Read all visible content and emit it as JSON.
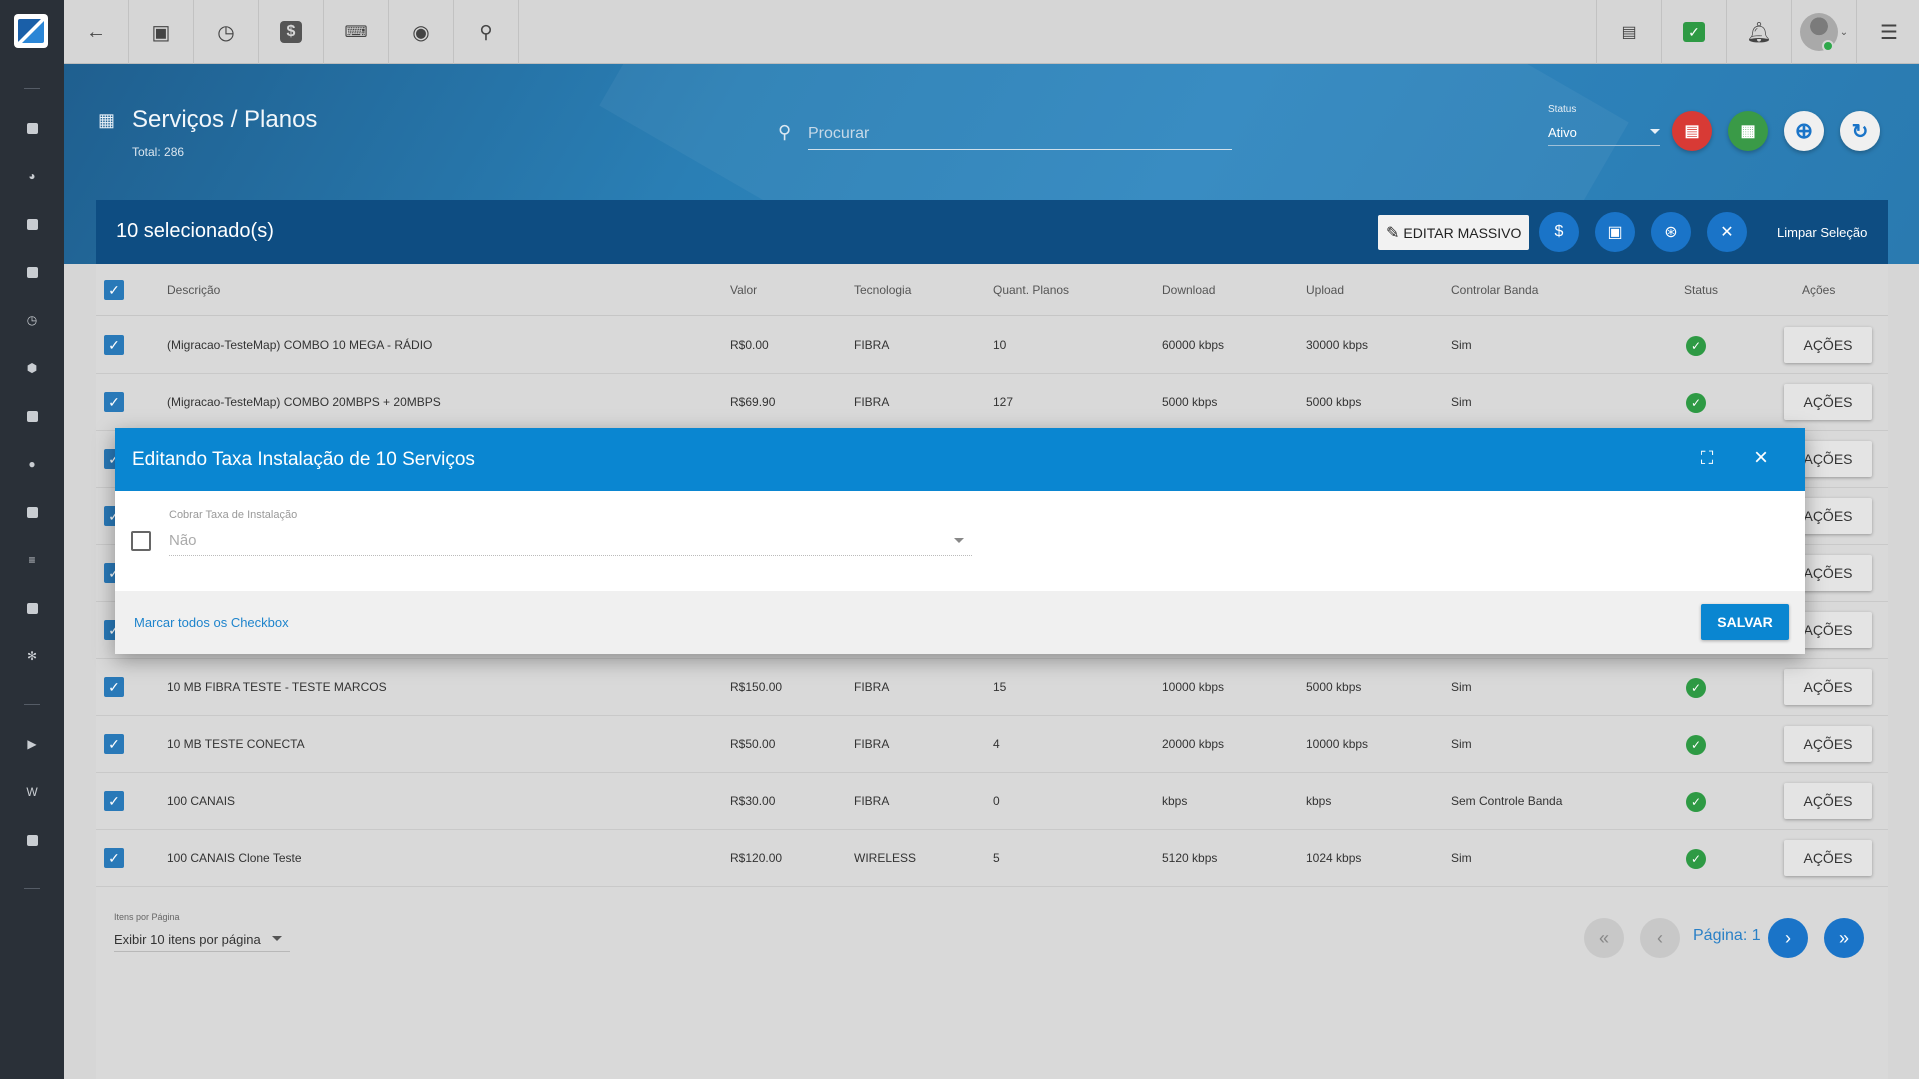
{
  "topbar": {
    "icons": [
      "back-arrow-icon",
      "contact-card-icon",
      "calendar-clock-icon",
      "dollar-icon",
      "terminal-icon",
      "eye-icon",
      "search-icon",
      "pdf-icon",
      "chat-check-icon",
      "bell-icon",
      "avatar",
      "menu-icon"
    ]
  },
  "page": {
    "title": "Serviços / Planos",
    "total": "Total: 286",
    "search_placeholder": "Procurar",
    "status_label": "Status",
    "status_value": "Ativo"
  },
  "selection": {
    "count": "10 selecionado(s)",
    "edit_mass": "EDITAR MASSIVO",
    "clear": "Limpar Seleção"
  },
  "table": {
    "headers": [
      "Descrição",
      "Valor",
      "Tecnologia",
      "Quant. Planos",
      "Download",
      "Upload",
      "Controlar Banda",
      "Status",
      "Ações"
    ],
    "rows": [
      {
        "desc": "(Migracao-TesteMap) COMBO 10 MEGA - RÁDIO",
        "valor": "R$0.00",
        "tec": "FIBRA",
        "quant": "10",
        "down": "60000 kbps",
        "up": "30000 kbps",
        "banda": "Sim"
      },
      {
        "desc": "(Migracao-TesteMap) COMBO 20MBPS + 20MBPS",
        "valor": "R$69.90",
        "tec": "FIBRA",
        "quant": "127",
        "down": "5000 kbps",
        "up": "5000 kbps",
        "banda": "Sim"
      },
      {
        "desc": "",
        "valor": "",
        "tec": "",
        "quant": "",
        "down": "",
        "up": "",
        "banda": ""
      },
      {
        "desc": "",
        "valor": "",
        "tec": "",
        "quant": "",
        "down": "",
        "up": "",
        "banda": ""
      },
      {
        "desc": "",
        "valor": "",
        "tec": "",
        "quant": "",
        "down": "",
        "up": "",
        "banda": ""
      },
      {
        "desc": "",
        "valor": "",
        "tec": "",
        "quant": "",
        "down": "",
        "up": "",
        "banda": ""
      },
      {
        "desc": "10 MB FIBRA TESTE - TESTE MARCOS",
        "valor": "R$150.00",
        "tec": "FIBRA",
        "quant": "15",
        "down": "10000 kbps",
        "up": "5000 kbps",
        "banda": "Sim"
      },
      {
        "desc": "10 MB TESTE CONECTA",
        "valor": "R$50.00",
        "tec": "FIBRA",
        "quant": "4",
        "down": "20000 kbps",
        "up": "10000 kbps",
        "banda": "Sim"
      },
      {
        "desc": "100 CANAIS",
        "valor": "R$30.00",
        "tec": "FIBRA",
        "quant": "0",
        "down": "kbps",
        "up": "kbps",
        "banda": "Sem Controle Banda"
      },
      {
        "desc": "100 CANAIS Clone Teste",
        "valor": "R$120.00",
        "tec": "WIRELESS",
        "quant": "5",
        "down": "5120 kbps",
        "up": "1024 kbps",
        "banda": "Sim"
      }
    ],
    "action_label": "AÇÕES"
  },
  "pagination": {
    "items_label": "Itens por Página",
    "items_value": "Exibir 10 itens por página",
    "page_label": "Página: 1"
  },
  "modal": {
    "title": "Editando Taxa Instalação de 10 Serviços",
    "field_label": "Cobrar Taxa de Instalação",
    "field_value": "Não",
    "mark_all": "Marcar todos os Checkbox",
    "save": "SALVAR"
  }
}
